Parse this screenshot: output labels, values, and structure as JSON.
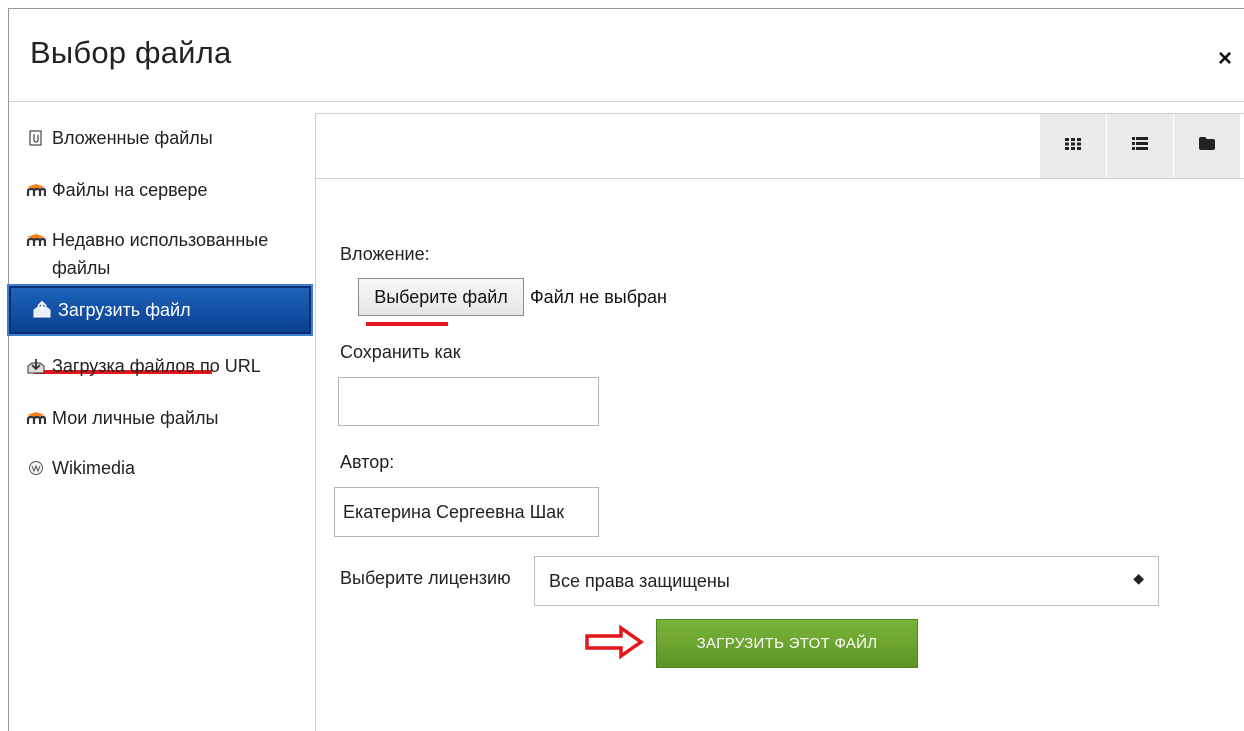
{
  "dialog": {
    "title": "Выбор файла",
    "close_label": "×"
  },
  "sidebar": {
    "items": [
      {
        "label": "Вложенные файлы",
        "icon": "attachment-icon"
      },
      {
        "label": "Файлы на сервере",
        "icon": "moodle-icon"
      },
      {
        "label": "Недавно использованные файлы",
        "icon": "moodle-icon"
      },
      {
        "label": "Загрузить файл",
        "icon": "upload-icon",
        "active": true
      },
      {
        "label": "Загрузка файлов по URL",
        "icon": "url-download-icon"
      },
      {
        "label": "Мои личные файлы",
        "icon": "moodle-icon"
      },
      {
        "label": "Wikimedia",
        "icon": "wikimedia-icon"
      }
    ]
  },
  "toolbar": {
    "views": [
      "icons-view-icon",
      "list-view-icon",
      "folder-view-icon"
    ]
  },
  "form": {
    "attachment_label": "Вложение:",
    "choose_button": "Выберите файл",
    "no_file_text": "Файл не выбран",
    "save_as_label": "Сохранить как",
    "save_as_value": "",
    "author_label": "Автор:",
    "author_value": "Екатерина Сергеевна Шак",
    "license_label": "Выберите лицензию",
    "license_value": "Все права защищены",
    "upload_button": "ЗАГРУЗИТЬ ЭТОТ ФАЙЛ"
  },
  "colors": {
    "active_item": "#0a4a9e",
    "upload_button": "#6aa52e",
    "annotation": "#e4151b"
  }
}
